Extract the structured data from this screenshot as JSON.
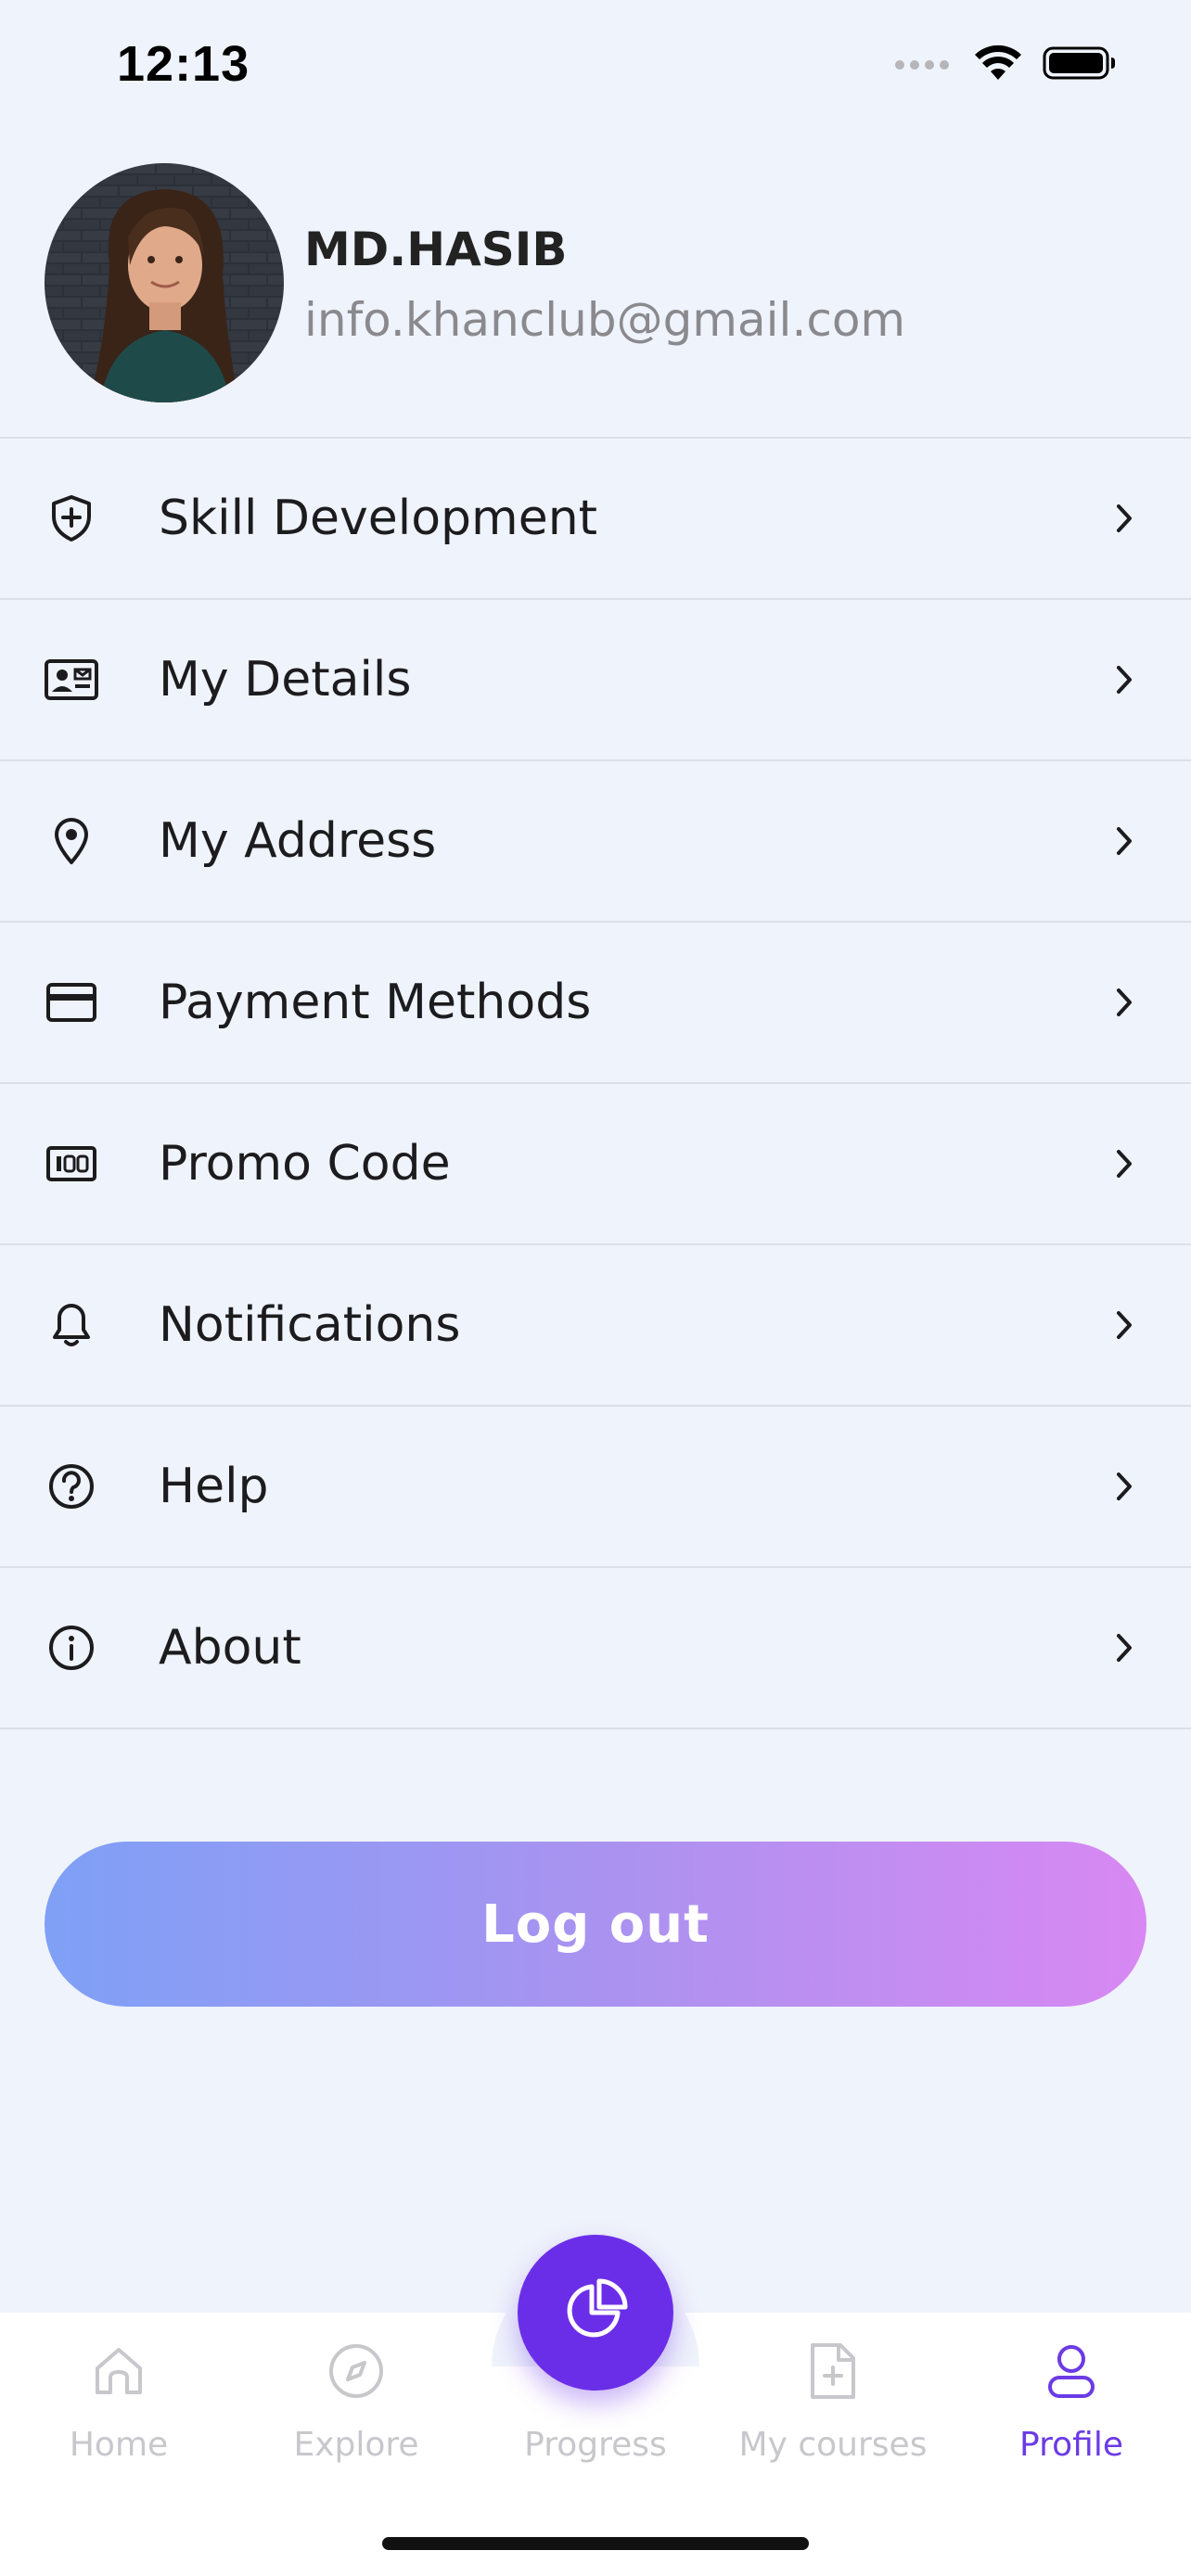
{
  "status_bar": {
    "time": "12:13"
  },
  "profile": {
    "name": "MD.HASIB",
    "email": "info.khanclub@gmail.com"
  },
  "menu": {
    "items": [
      {
        "label": "Skill Development",
        "icon": "shield-plus-icon"
      },
      {
        "label": "My Details",
        "icon": "id-card-icon"
      },
      {
        "label": "My Address",
        "icon": "location-pin-icon"
      },
      {
        "label": "Payment Methods",
        "icon": "credit-card-icon"
      },
      {
        "label": "Promo Code",
        "icon": "promo-code-icon"
      },
      {
        "label": "Notifications",
        "icon": "bell-icon"
      },
      {
        "label": "Help",
        "icon": "question-circle-icon"
      },
      {
        "label": "About",
        "icon": "info-circle-icon"
      }
    ]
  },
  "logout": {
    "label": "Log out"
  },
  "tab_bar": {
    "tabs": [
      {
        "label": "Home",
        "icon": "home-icon"
      },
      {
        "label": "Explore",
        "icon": "compass-icon"
      },
      {
        "label": "Progress",
        "icon": "pie-chart-icon"
      },
      {
        "label": "My courses",
        "icon": "document-add-icon"
      },
      {
        "label": "Profile",
        "icon": "user-icon"
      }
    ],
    "active": "Profile",
    "accent_color": "#6b2ee8",
    "inactive_color": "#c7c7cc"
  }
}
